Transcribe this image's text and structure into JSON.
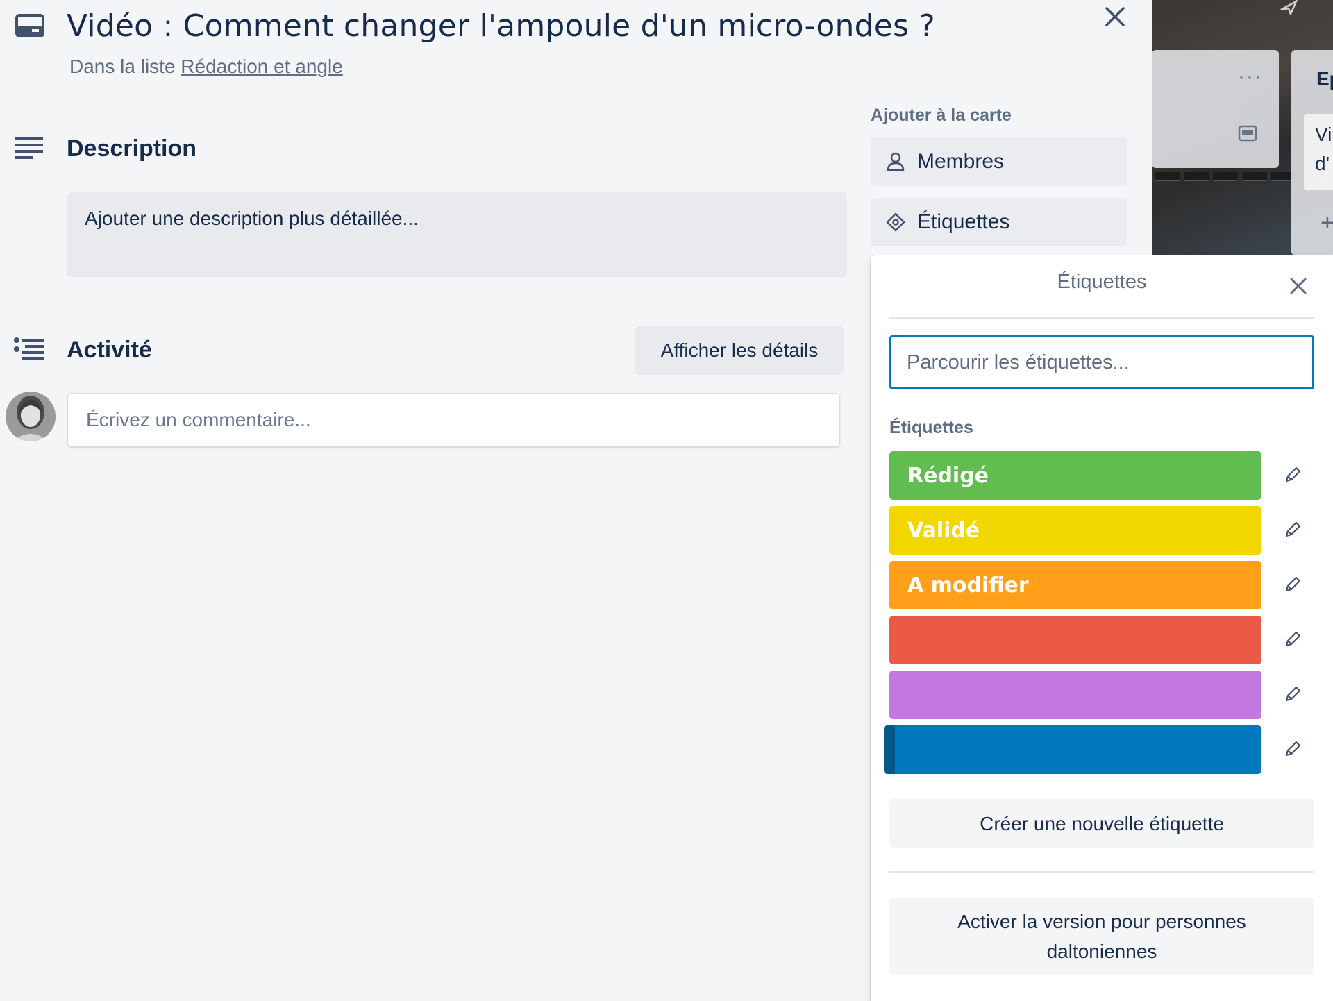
{
  "card": {
    "title": "Vidéo : Comment changer l'ampoule d'un micro-ondes ?",
    "list_prefix": "Dans la liste ",
    "list_name": "Rédaction et angle"
  },
  "description": {
    "title": "Description",
    "placeholder": "Ajouter une description plus détaillée..."
  },
  "activity": {
    "title": "Activité",
    "details_button": "Afficher les détails",
    "comment_placeholder": "Écrivez un commentaire..."
  },
  "sidebar": {
    "add_to_card_label": "Ajouter à la carte",
    "buttons": [
      {
        "label": "Membres",
        "icon": "person-icon"
      },
      {
        "label": "Étiquettes",
        "icon": "tag-icon"
      }
    ]
  },
  "background_board": {
    "ellipsis": "···",
    "list_title_fragment": "Ep",
    "card_text_line1": "Vi",
    "card_text_line2": "d'",
    "plus": "+"
  },
  "labels_popover": {
    "title": "Étiquettes",
    "search_placeholder": "Parcourir les étiquettes...",
    "section_heading": "Étiquettes",
    "labels": [
      {
        "name": "Rédigé",
        "color": "#61bd4f"
      },
      {
        "name": "Validé",
        "color": "#f2d600"
      },
      {
        "name": "A modifier",
        "color": "#ff9f1a"
      },
      {
        "name": "",
        "color": "#eb5a46"
      },
      {
        "name": "",
        "color": "#c377e0"
      },
      {
        "name": "",
        "color": "#0079bf",
        "focused": true
      }
    ],
    "create_button": "Créer une nouvelle étiquette",
    "colorblind_button_line1": "Activer la version pour personnes",
    "colorblind_button_line2": "daltoniennes"
  },
  "colors": {
    "accent": "#0079bf",
    "text": "#172b4d",
    "muted": "#5e6c84",
    "background": "#f4f5f7"
  }
}
